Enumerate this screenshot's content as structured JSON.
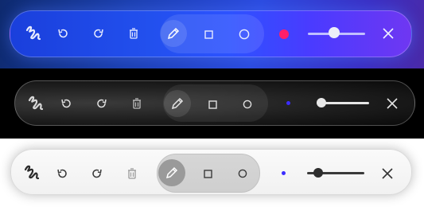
{
  "toolbars": [
    {
      "theme": "gradient-blue",
      "tools": [
        "scribble-logo-icon",
        "undo-icon",
        "redo-icon",
        "trash-icon",
        "pencil-icon",
        "rectangle-icon",
        "circle-icon"
      ],
      "active_tool": "pencil",
      "color": "#ff1f6a",
      "stroke_level": 0.45,
      "close": "close-icon"
    },
    {
      "theme": "dark",
      "tools": [
        "scribble-logo-icon",
        "undo-icon",
        "redo-icon",
        "trash-icon",
        "pencil-icon",
        "rectangle-icon",
        "circle-icon"
      ],
      "active_tool": "pencil",
      "color": "#3b2cff",
      "stroke_level": 0.15,
      "close": "close-icon"
    },
    {
      "theme": "light",
      "tools": [
        "scribble-logo-icon",
        "undo-icon",
        "redo-icon",
        "trash-icon",
        "pencil-icon",
        "rectangle-icon",
        "circle-icon"
      ],
      "active_tool": "pencil",
      "color": "#3b2cff",
      "stroke_level": 0.2,
      "close": "close-icon"
    }
  ]
}
